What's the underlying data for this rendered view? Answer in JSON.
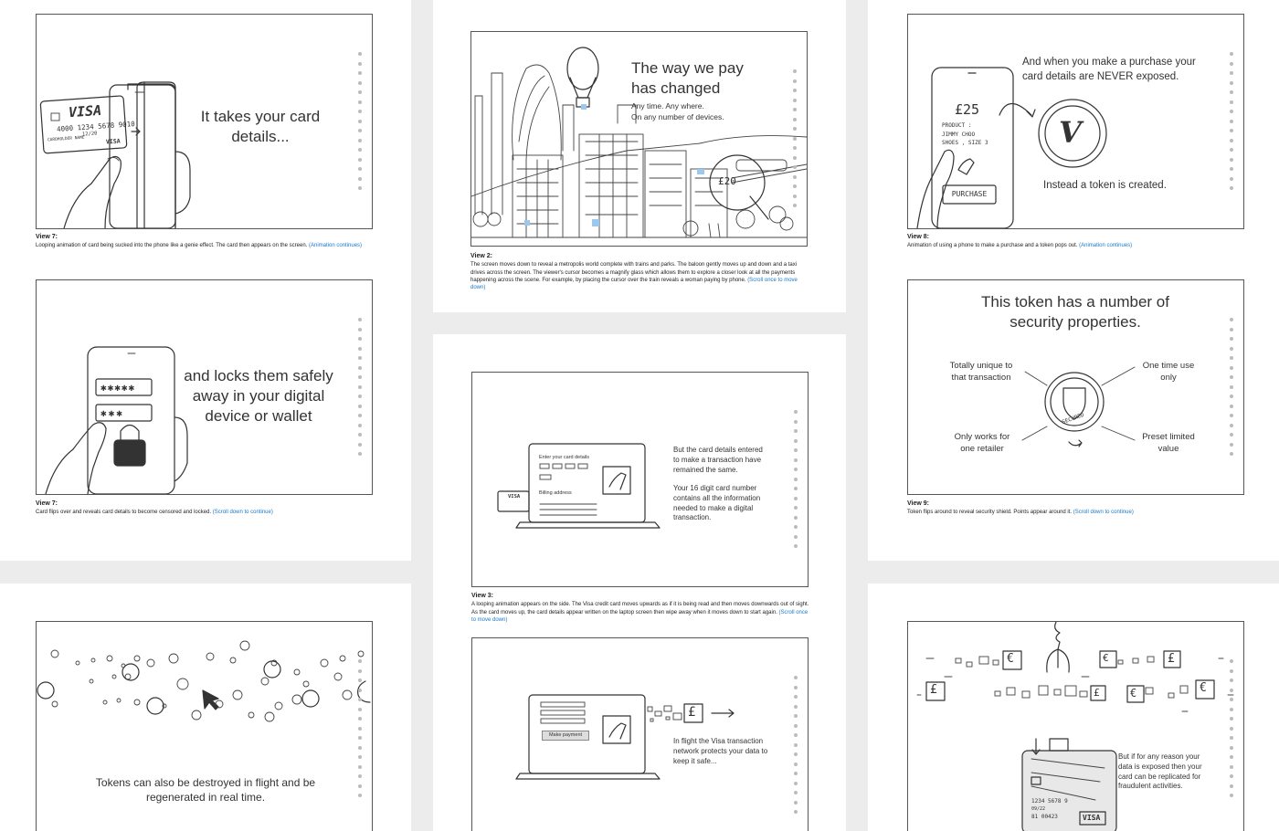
{
  "views": {
    "v7a": {
      "headline": "It takes your card details...",
      "card_brand": "VISA",
      "card_number": "4000 1234 5678 9010",
      "card_expiry": "12/20",
      "card_name": "CARDHOLDER NAME",
      "card_brand_small": "VISA",
      "label": "View 7:",
      "desc": "Looping animation of card being sucked into the phone like a genie effect. The card then appears on the screen.",
      "link": "(Animation continues)"
    },
    "v2": {
      "headline": "The way we pay has changed",
      "sub1": "Any time. Any where.",
      "sub2": "On any number of devices.",
      "price_tag": "£20",
      "label": "View 2:",
      "desc": "The screen moves down to reveal a metropolis world complete with trains and parks. The baloon gently moves up and down and a taxi drives across the screen. The viewer's cursor becomes a magnify glass which allows them to explore a closer look at all the payments happening across the scene. For example, by placing the cursor over the train reveals a woman paying by phone.",
      "link": "(Scroll once to move down)"
    },
    "v8": {
      "headline": "And when you make a purchase your card details are NEVER exposed.",
      "sub": "Instead a token is created.",
      "phone_price": "£25",
      "phone_product_label": "PRODUCT :",
      "phone_product_name": "JIMMY CHOO",
      "phone_product_detail": "SHOES , SIZE 3",
      "purchase_btn": "PURCHASE",
      "token_letter": "V",
      "label": "View 8:",
      "desc": "Animation of using a phone to make a purchase and a token pops out.",
      "link": "(Animation continues)"
    },
    "v7b": {
      "headline": "and locks them safely away in your digital device or wallet",
      "masked1": "✱✱✱✱✱",
      "masked2": "✱✱✱",
      "label": "View 7:",
      "desc": "Card flips over and reveals card details to become censored and locked.",
      "link": "(Scroll down to continue)"
    },
    "v3": {
      "form_title": "Enter your card details",
      "billing": "Billing address",
      "card_brand": "VISA",
      "text1": "But the card details entered to make a transaction have remained the same.",
      "text2": "Your 16 digit card number contains all the information needed to make a digital transaction.",
      "label": "View 3:",
      "desc": "A looping animation appears on the side. The Visa credit card moves upwards as if it is being read and then moves downwards out of sight. As the card moves up, the card details appear written on the laptop screen then wipe away when it moves down to start again.",
      "link": "(Scroll once to move down)"
    },
    "v9": {
      "headline": "This token has a number of security properties.",
      "prop1": "Totally unique to that transaction",
      "prop2": "One time use only",
      "prop3": "Only works for one retailer",
      "prop4": "Preset limited value",
      "shield_text": "SECURED",
      "label": "View 9:",
      "desc": "Token flips around to reveal security shield. Points appear around it.",
      "link": "(Scroll down to continue)"
    },
    "v10": {
      "text": "Tokens can also be destroyed in flight and be regenerated in real time."
    },
    "v4": {
      "button": "Make payment",
      "currency": "£",
      "text": "In flight the Visa transaction network protects your data to keep it safe..."
    },
    "v11": {
      "text": "But if for any reason your data is exposed then your card can be replicated for fraudulent activities.",
      "card_number": "1234 5678 9",
      "card_expiry": "09/22",
      "card_code": "81 00423",
      "card_brand": "VISA",
      "currency_euro": "€",
      "currency_pound": "£"
    }
  }
}
